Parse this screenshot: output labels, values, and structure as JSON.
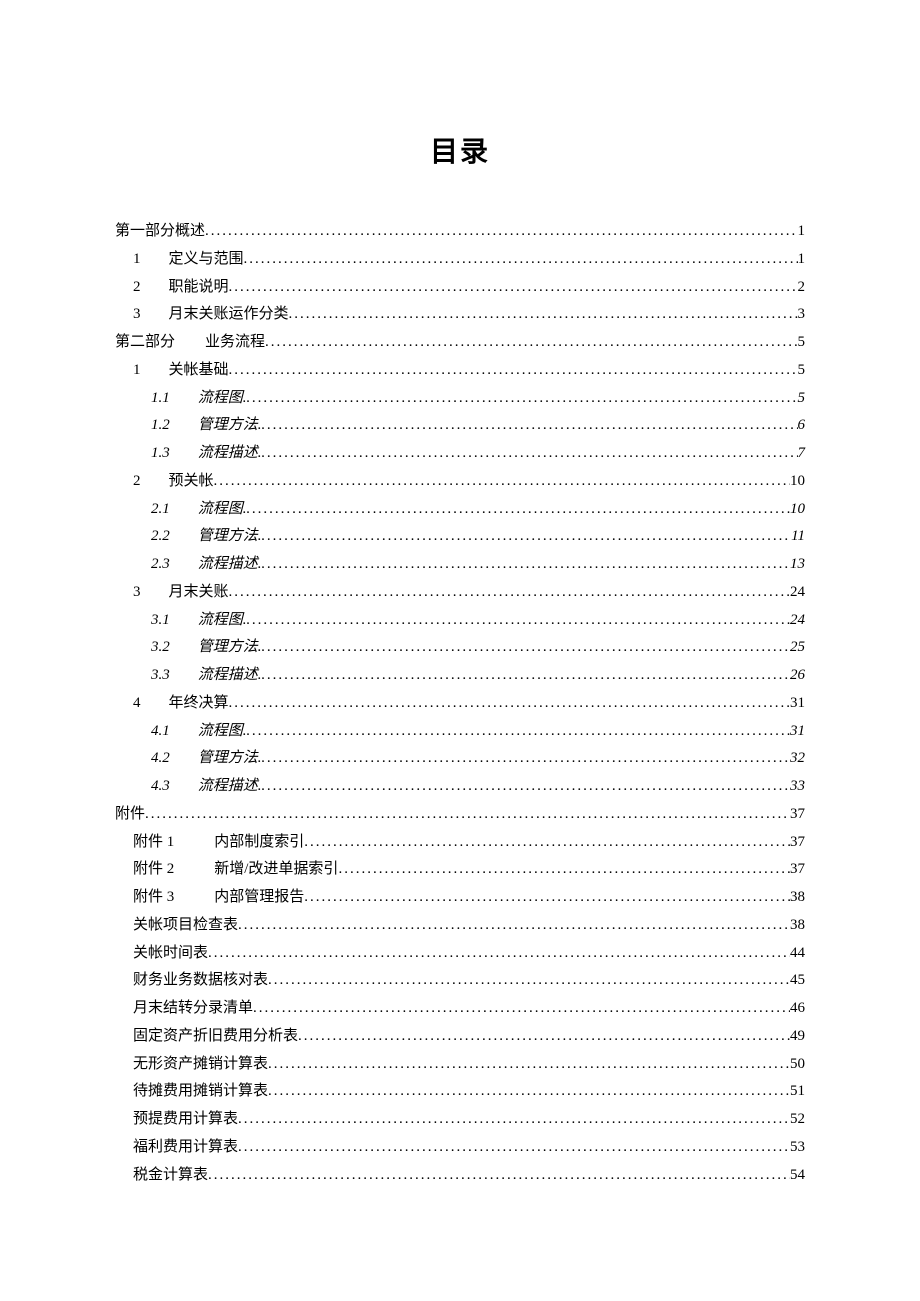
{
  "title": "目录",
  "entries": [
    {
      "level": 0,
      "num": "",
      "text": "第一部分概述",
      "page": "1",
      "italic": false,
      "gap": false
    },
    {
      "level": 1,
      "num": "1",
      "text": "定义与范围",
      "page": "1",
      "italic": false,
      "gap": true
    },
    {
      "level": 1,
      "num": "2",
      "text": "职能说明",
      "page": "2",
      "italic": false,
      "gap": true
    },
    {
      "level": 1,
      "num": "3",
      "text": "月末关账运作分类",
      "page": "3",
      "italic": false,
      "gap": true
    },
    {
      "level": 0,
      "num": "",
      "text": "第二部分　　业务流程",
      "page": "5",
      "italic": false,
      "gap": false
    },
    {
      "level": 1,
      "num": "1",
      "text": "关帐基础",
      "page": "5",
      "italic": false,
      "gap": true
    },
    {
      "level": 2,
      "num": "1.1",
      "text": "流程图.",
      "page": "5",
      "italic": true,
      "gap": true
    },
    {
      "level": 2,
      "num": "1.2",
      "text": "管理方法.",
      "page": "6",
      "italic": true,
      "gap": true
    },
    {
      "level": 2,
      "num": "1.3",
      "text": "流程描述.",
      "page": "7",
      "italic": true,
      "gap": true
    },
    {
      "level": 1,
      "num": "2",
      "text": "预关帐",
      "page": "10",
      "italic": false,
      "gap": true
    },
    {
      "level": 2,
      "num": "2.1",
      "text": "流程图.",
      "page": "10",
      "italic": true,
      "gap": true
    },
    {
      "level": 2,
      "num": "2.2",
      "text": "管理方法.",
      "page": "11",
      "italic": true,
      "gap": true
    },
    {
      "level": 2,
      "num": "2.3",
      "text": "流程描述.",
      "page": "13",
      "italic": true,
      "gap": true
    },
    {
      "level": 1,
      "num": "3",
      "text": "月末关账",
      "page": "24",
      "italic": false,
      "gap": true
    },
    {
      "level": 2,
      "num": "3.1",
      "text": "流程图.",
      "page": "24",
      "italic": true,
      "gap": true
    },
    {
      "level": 2,
      "num": "3.2",
      "text": "管理方法.",
      "page": "25",
      "italic": true,
      "gap": true
    },
    {
      "level": 2,
      "num": "3.3",
      "text": "流程描述.",
      "page": "26",
      "italic": true,
      "gap": true
    },
    {
      "level": 1,
      "num": "4",
      "text": "年终决算",
      "page": "31",
      "italic": false,
      "gap": true
    },
    {
      "level": 2,
      "num": "4.1",
      "text": "流程图.",
      "page": "31",
      "italic": true,
      "gap": true
    },
    {
      "level": 2,
      "num": "4.2",
      "text": "管理方法.",
      "page": "32",
      "italic": true,
      "gap": true
    },
    {
      "level": 2,
      "num": "4.3",
      "text": "流程描述.",
      "page": "33",
      "italic": true,
      "gap": true
    },
    {
      "level": 0,
      "num": "",
      "text": "附件",
      "page": "37",
      "italic": false,
      "gap": false
    },
    {
      "level": 1,
      "num": "附件 1",
      "text": "内部制度索引",
      "page": "37",
      "italic": false,
      "gap": true,
      "wideNum": true
    },
    {
      "level": 1,
      "num": "附件 2",
      "text": "新增/改进单据索引",
      "page": "37",
      "italic": false,
      "gap": true,
      "wideNum": true
    },
    {
      "level": 1,
      "num": "附件 3",
      "text": "内部管理报告",
      "page": "38",
      "italic": false,
      "gap": true,
      "wideNum": true
    },
    {
      "level": 1,
      "num": "",
      "text": "关帐项目检查表",
      "page": "38",
      "italic": false,
      "gap": false
    },
    {
      "level": 1,
      "num": "",
      "text": "关帐时间表",
      "page": "44",
      "italic": false,
      "gap": false
    },
    {
      "level": 1,
      "num": "",
      "text": "财务业务数据核对表",
      "page": "45",
      "italic": false,
      "gap": false
    },
    {
      "level": 1,
      "num": "",
      "text": "月末结转分录清单",
      "page": "46",
      "italic": false,
      "gap": false
    },
    {
      "level": 1,
      "num": "",
      "text": "固定资产折旧费用分析表",
      "page": "49",
      "italic": false,
      "gap": false
    },
    {
      "level": 1,
      "num": "",
      "text": "无形资产摊销计算表",
      "page": "50",
      "italic": false,
      "gap": false
    },
    {
      "level": 1,
      "num": "",
      "text": "待摊费用摊销计算表",
      "page": "51",
      "italic": false,
      "gap": false
    },
    {
      "level": 1,
      "num": "",
      "text": "预提费用计算表",
      "page": "52",
      "italic": false,
      "gap": false
    },
    {
      "level": 1,
      "num": "",
      "text": "福利费用计算表",
      "page": "53",
      "italic": false,
      "gap": false
    },
    {
      "level": 1,
      "num": "",
      "text": "税金计算表",
      "page": "54",
      "italic": false,
      "gap": false
    }
  ]
}
